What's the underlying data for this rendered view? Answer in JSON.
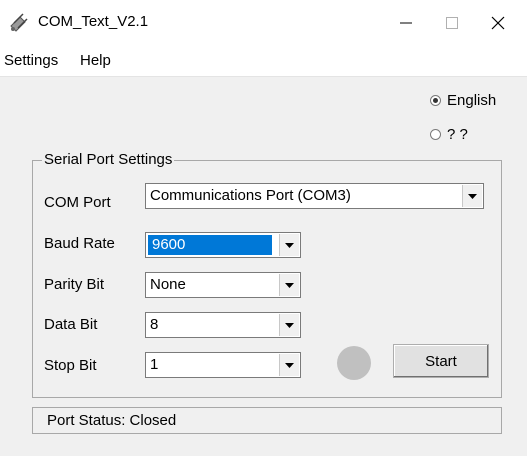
{
  "window": {
    "title": "COM_Text_V2.1",
    "icon": "satellite-dish-icon",
    "minimize_symbol": "—",
    "maximize_symbol": "☐",
    "close_symbol": "✕"
  },
  "menu": {
    "items": [
      {
        "label": "Settings"
      },
      {
        "label": "Help"
      }
    ]
  },
  "language": {
    "options": [
      {
        "label": "English",
        "selected": true
      },
      {
        "label": "? ?",
        "selected": false
      }
    ]
  },
  "serial": {
    "group_title": "Serial Port Settings",
    "com_port": {
      "label": "COM Port",
      "value": "Communications Port (COM3)"
    },
    "baud_rate": {
      "label": "Baud Rate",
      "value": "9600"
    },
    "parity_bit": {
      "label": "Parity Bit",
      "value": "None"
    },
    "data_bit": {
      "label": "Data Bit",
      "value": "8"
    },
    "stop_bit": {
      "label": "Stop Bit",
      "value": "1"
    }
  },
  "controls": {
    "start_label": "Start",
    "indicator_color": "#c0c0c0"
  },
  "status": {
    "text": "Port Status: Closed"
  },
  "colors": {
    "selection": "#0078d7",
    "titlebar": "#ffffff",
    "window_bg": "#f0f0f0"
  }
}
